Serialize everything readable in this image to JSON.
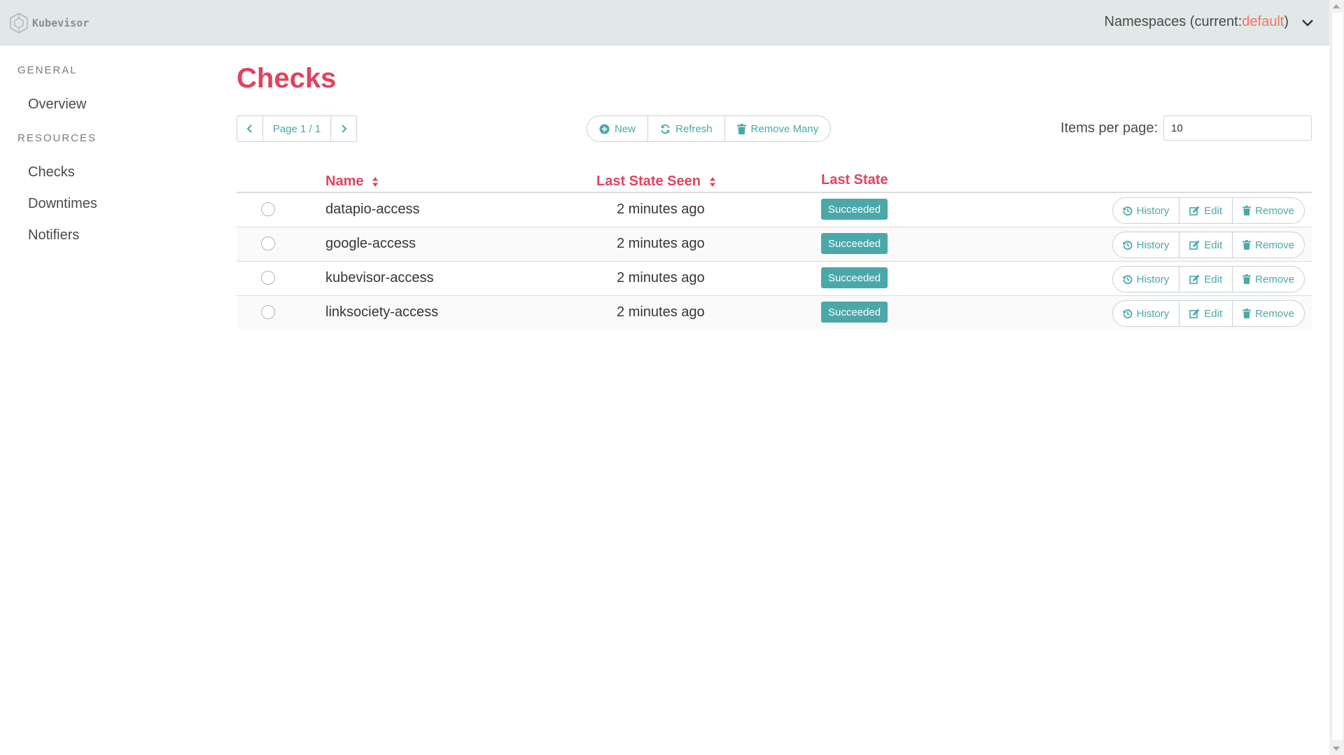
{
  "app": {
    "brand": "Kubevisor"
  },
  "namespace": {
    "prefix": "Namespaces (current: ",
    "current": "default",
    "suffix": ")"
  },
  "sidebar": {
    "general_label": "GENERAL",
    "resources_label": "RESOURCES",
    "items": [
      {
        "label": "Overview"
      },
      {
        "label": "Checks"
      },
      {
        "label": "Downtimes"
      },
      {
        "label": "Notifiers"
      }
    ]
  },
  "page": {
    "title": "Checks"
  },
  "pager": {
    "label": "Page 1 / 1"
  },
  "toolbar": {
    "new": "New",
    "refresh": "Refresh",
    "remove_many": "Remove Many"
  },
  "items_per_page": {
    "label": "Items per page:",
    "value": "10"
  },
  "table": {
    "headers": {
      "name": "Name",
      "last_state_seen": "Last State Seen",
      "last_state": "Last State"
    },
    "row_actions": {
      "history": "History",
      "edit": "Edit",
      "remove": "Remove"
    },
    "rows": [
      {
        "name": "datapio-access",
        "seen": "2 minutes ago",
        "state": "Succeeded"
      },
      {
        "name": "google-access",
        "seen": "2 minutes ago",
        "state": "Succeeded"
      },
      {
        "name": "kubevisor-access",
        "seen": "2 minutes ago",
        "state": "Succeeded"
      },
      {
        "name": "linksociety-access",
        "seen": "2 minutes ago",
        "state": "Succeeded"
      }
    ]
  },
  "colors": {
    "accent": "#e1435e",
    "primary": "#4aa8a8",
    "topbar": "#e1e8e8",
    "namespace_current": "#f07662"
  }
}
